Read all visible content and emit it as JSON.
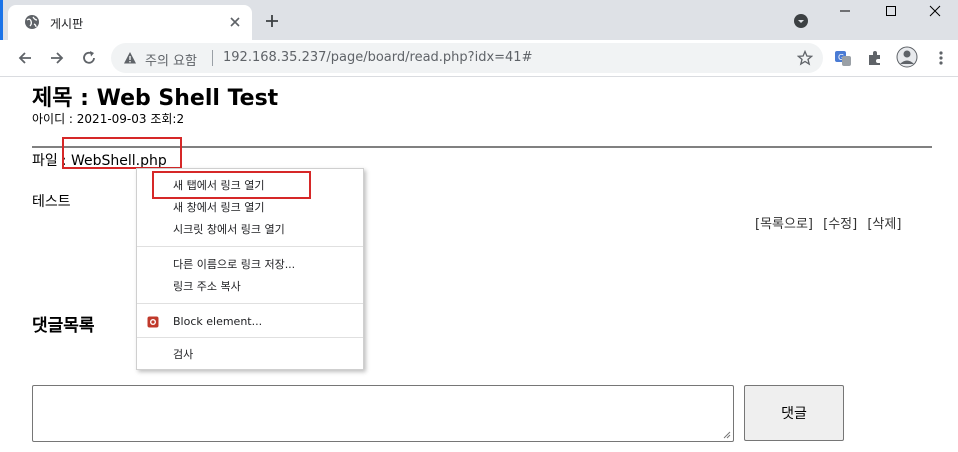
{
  "browser": {
    "tab_title": "게시판",
    "security_label": "주의 요함",
    "url": "192.168.35.237/page/board/read.php?idx=41#"
  },
  "post": {
    "title": "제목 : Web Shell Test",
    "meta": "아이디 : 2021-09-03 조회:2",
    "file_label": "파일",
    "file_sep": ":",
    "file_name": "WebShell.php",
    "content": "테스트",
    "actions": {
      "list": "[목록으로]",
      "edit": "[수정]",
      "delete": "[삭제]"
    }
  },
  "comments": {
    "title": "댓글목록",
    "submit_label": "댓글"
  },
  "context_menu": {
    "items": [
      "새 탭에서 링크 열기",
      "새 창에서 링크 열기",
      "시크릿 창에서 링크 열기",
      "다른 이름으로 링크 저장...",
      "링크 주소 복사",
      "Block element...",
      "검사"
    ]
  },
  "colors": {
    "highlight_box": "#d62828",
    "tabstrip": "#dee1e6",
    "block_icon": "#c0392b"
  }
}
